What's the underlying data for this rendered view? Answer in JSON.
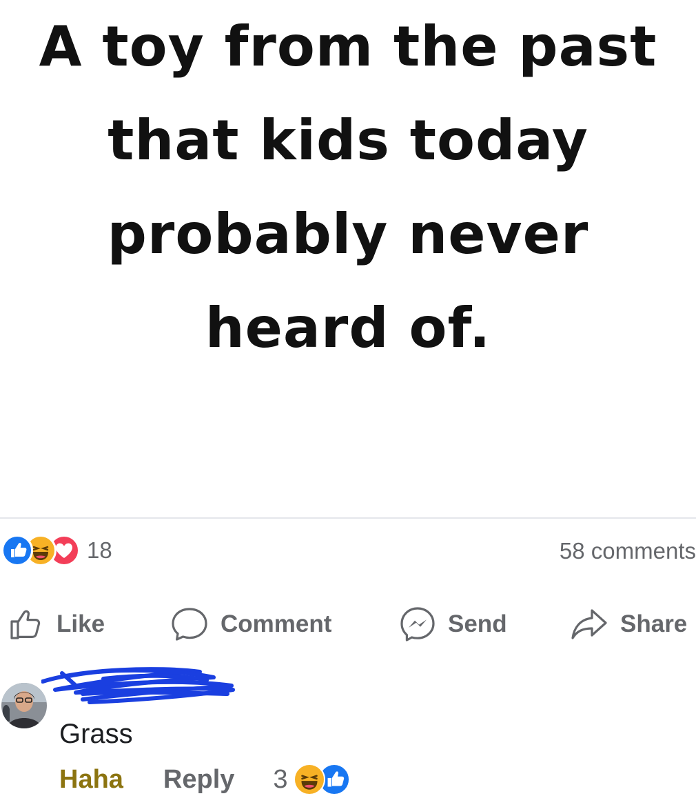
{
  "post": {
    "image_text_lines": [
      "A toy from the past",
      "that kids today",
      "probably never",
      "heard of."
    ]
  },
  "reactions": {
    "icons": [
      "like-icon",
      "haha-icon",
      "love-icon"
    ],
    "count": "18"
  },
  "comments_count": "58 comments",
  "actions": {
    "like": "Like",
    "comment": "Comment",
    "send": "Send",
    "share": "Share"
  },
  "comment": {
    "text": "Grass",
    "haha_label": "Haha",
    "reply_label": "Reply",
    "reaction_count": "3",
    "reaction_icons": [
      "haha-icon",
      "like-icon"
    ]
  },
  "colors": {
    "like_blue": "#1877f2",
    "love_red": "#f33e58",
    "haha_yellow": "#f7b125",
    "haha_text": "#8c7410",
    "muted_gray": "#65676b",
    "scribble_blue": "#1a3fe0"
  }
}
